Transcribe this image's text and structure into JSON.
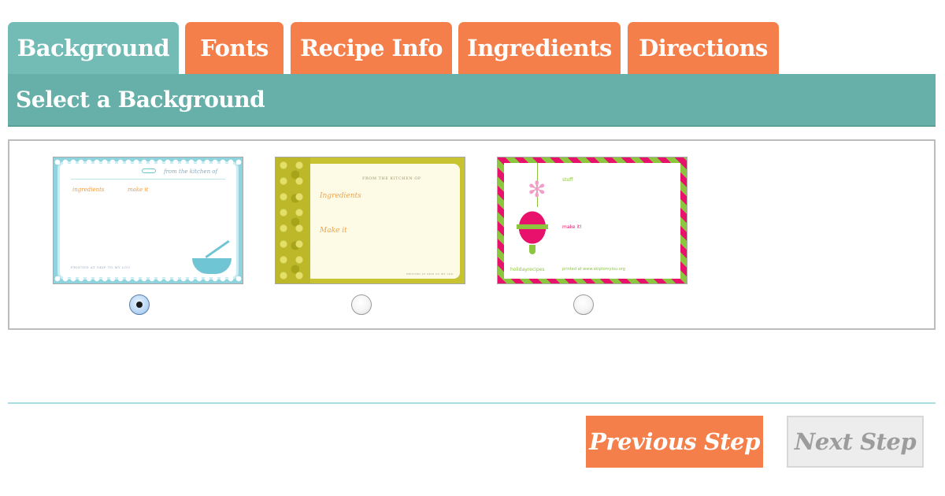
{
  "tabs": [
    {
      "label": "Background",
      "active": true
    },
    {
      "label": "Fonts",
      "active": false
    },
    {
      "label": "Recipe Info",
      "active": false
    },
    {
      "label": "Ingredients",
      "active": false
    },
    {
      "label": "Directions",
      "active": false
    }
  ],
  "section": {
    "title": "Select a Background"
  },
  "backgrounds": [
    {
      "name": "blue-scallop",
      "selected": true,
      "from_text": "from the kitchen of",
      "ingredients_text": "ingredients",
      "make_text": "make it",
      "footer_text": "PRINTED AT SKIP TO MY LOU"
    },
    {
      "name": "yellow-lace",
      "selected": false,
      "from_text": "FROM THE KITCHEN OF",
      "ingredients_text": "Ingredients",
      "make_text": "Make it",
      "footer_text": "PRINTED AT SKIP TO MY LOU"
    },
    {
      "name": "holiday",
      "selected": false,
      "stuff_text": "stuff",
      "make_text": "make it!",
      "brand_text": "holidayrecipes",
      "printed_text": "printed at www.skiptomylou.org"
    }
  ],
  "buttons": {
    "previous": "Previous Step",
    "next": "Next Step"
  },
  "colors": {
    "active_tab": "#72bcb5",
    "inactive_tab": "#f47f4a",
    "section_bar": "#67afa9",
    "previous_button": "#f47f4a",
    "next_button_disabled": "#ededed"
  }
}
